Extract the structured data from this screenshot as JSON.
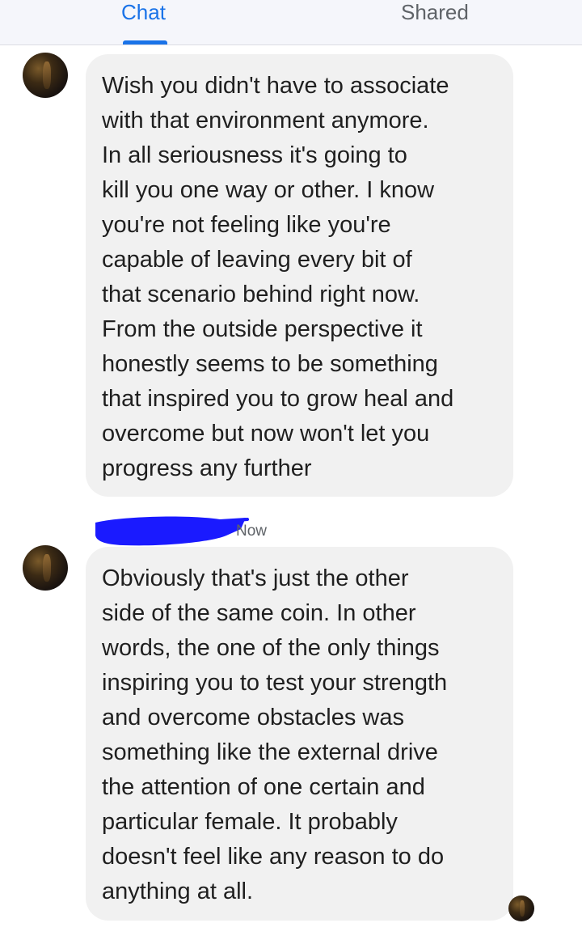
{
  "tabs": {
    "chat": "Chat",
    "shared": "Shared"
  },
  "messages": [
    {
      "lines": [
        "Wish you didn't have to associate",
        "with that environment anymore.",
        "In all seriousness it's going to",
        "kill you one way or other. I know",
        "you're not feeling like you're",
        "capable of leaving every bit of",
        "that scenario behind right now.",
        "From the outside perspective it",
        "honestly seems to be something",
        "that inspired you to grow heal and",
        "overcome but now won't let you",
        "progress any further"
      ]
    },
    {
      "timestamp": "Now",
      "lines": [
        "Obviously that's just the other",
        "side of the same coin. In other",
        "words, the one of the only things",
        "inspiring you to test your strength",
        "and overcome obstacles was",
        "something like the external drive",
        "the attention of one certain and",
        "particular female. It probably",
        "doesn't feel like any reason to do",
        "anything at all."
      ]
    }
  ],
  "colors": {
    "accent": "#1a73e8",
    "bubble": "#f1f1f1",
    "redaction": "#1a1aff"
  }
}
